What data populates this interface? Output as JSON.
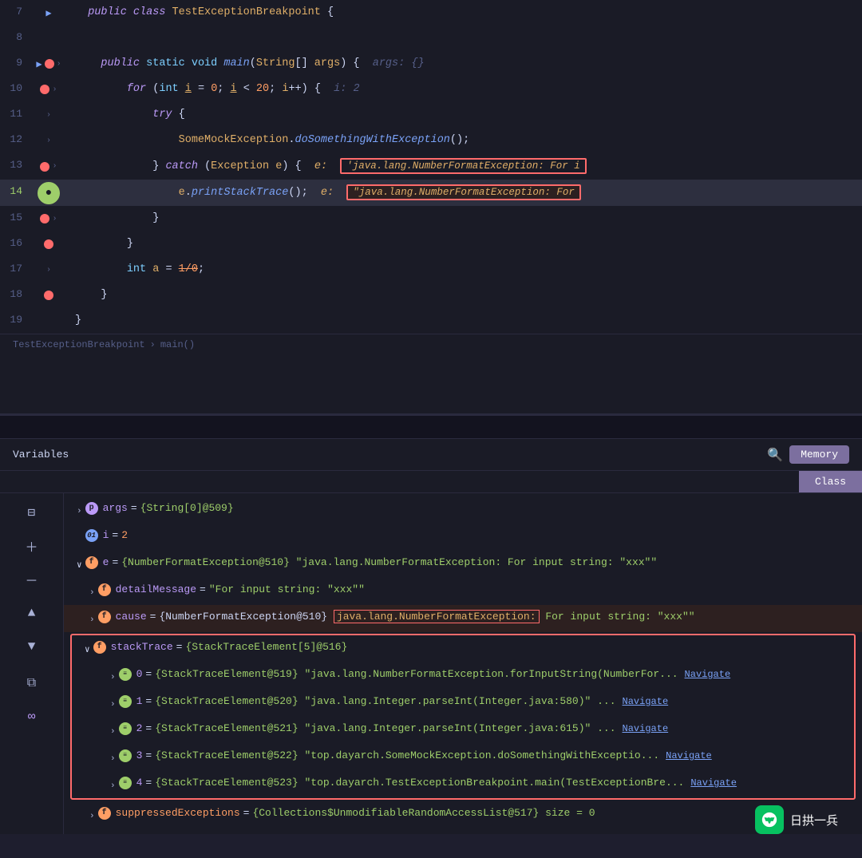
{
  "editor": {
    "lines": [
      {
        "num": 7,
        "gutter": "arrow",
        "code": "public_class_TestExceptionBreakpoint",
        "raw": "  <span class='kw'>public</span> <span class='kw'>class</span> <span class='cls'>TestExceptionBreakpoint</span> <span class='brace'>{</span>"
      }
    ],
    "breadcrumb": {
      "file": "TestExceptionBreakpoint",
      "method": "main()"
    }
  },
  "debug": {
    "tab_variables": "Variables",
    "tab_memory": "Memory",
    "tab_class": "Class",
    "variables": [
      {
        "id": "args",
        "badge": "p",
        "name": "args",
        "value": "= {String[0]@509}",
        "indent": 0,
        "expanded": false
      },
      {
        "id": "i",
        "badge": "i",
        "name": "i",
        "value": "= 2",
        "indent": 0,
        "expanded": false
      },
      {
        "id": "e",
        "badge": "f",
        "name": "e",
        "value": "= {NumberFormatException@510} \"java.lang.NumberFormatException: For input string: \\\"xxx\\\"\"",
        "indent": 0,
        "expanded": true
      },
      {
        "id": "detailMessage",
        "badge": "f",
        "name": "detailMessage",
        "value": "= \"For input string: \\\"xxx\\\"\"",
        "indent": 1,
        "expanded": false
      },
      {
        "id": "cause",
        "badge": "f",
        "name": "cause",
        "value": "= {NumberFormatException@510} \"java.lang.NumberFormatException: For input string: \\\"xxx\\\"\"",
        "indent": 1,
        "expanded": false,
        "highlighted": true
      },
      {
        "id": "stackTrace",
        "badge": "f",
        "name": "stackTrace",
        "value": "= {StackTraceElement[5]@516}",
        "indent": 1,
        "expanded": true,
        "highlighted": true,
        "box_start": true
      },
      {
        "id": "st0",
        "badge": "arr",
        "name": "0",
        "value": "= {StackTraceElement@519} \"java.lang.NumberFormatException.forInputString(NumberFor...\"",
        "link": "Navigate",
        "indent": 2,
        "expanded": false,
        "highlighted": true
      },
      {
        "id": "st1",
        "badge": "arr",
        "name": "1",
        "value": "= {StackTraceElement@520} \"java.lang.Integer.parseInt(Integer.java:580)\" ...",
        "link": "Navigate",
        "indent": 2,
        "expanded": false,
        "highlighted": true
      },
      {
        "id": "st2",
        "badge": "arr",
        "name": "2",
        "value": "= {StackTraceElement@521} \"java.lang.Integer.parseInt(Integer.java:615)\" ...",
        "link": "Navigate",
        "indent": 2,
        "expanded": false,
        "highlighted": true
      },
      {
        "id": "st3",
        "badge": "arr",
        "name": "3",
        "value": "= {StackTraceElement@522} \"top.dayarch.SomeMockException.doSomethingWithExceptio...\"",
        "link": "Navigate",
        "indent": 2,
        "expanded": false,
        "highlighted": true
      },
      {
        "id": "st4",
        "badge": "arr",
        "name": "4",
        "value": "= {StackTraceElement@523} \"top.dayarch.TestExceptionBreakpoint.main(TestExceptionBre...\"",
        "link": "Navigate",
        "indent": 2,
        "expanded": false,
        "highlighted": true,
        "box_end": true
      },
      {
        "id": "suppressedExceptions",
        "badge": "f",
        "name": "suppressedExceptions",
        "value": "= {Collections$UnmodifiableRandomAccessList@517}  size = 0",
        "indent": 1,
        "expanded": false
      }
    ]
  },
  "watermark": {
    "text": "日拱一兵"
  }
}
